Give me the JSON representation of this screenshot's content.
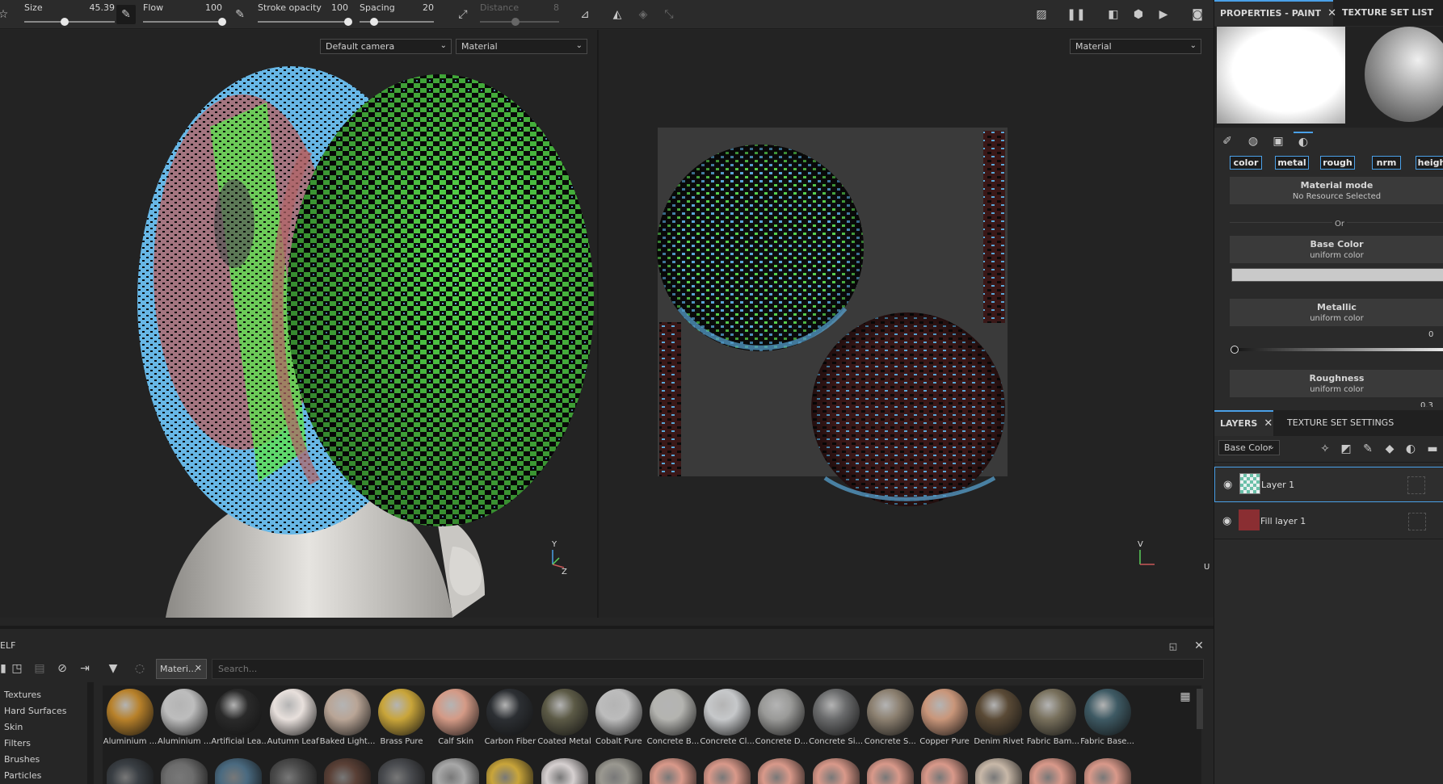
{
  "toolbar": {
    "size": {
      "label": "Size",
      "value": "45.39",
      "level": 0.45
    },
    "flow": {
      "label": "Flow",
      "value": "100",
      "level": 1.0
    },
    "stroke_opacity": {
      "label": "Stroke opacity",
      "value": "100",
      "level": 1.0
    },
    "spacing": {
      "label": "Spacing",
      "value": "20",
      "level": 0.2
    },
    "distance": {
      "label": "Distance",
      "value": "8",
      "level": 0.45
    }
  },
  "viewport3d": {
    "camera_select": "Default camera",
    "channel_select": "Material",
    "axis_y": "Y",
    "axis_z": "Z"
  },
  "viewport2d": {
    "channel_select": "Material",
    "axis_v": "V",
    "axis_u": "U"
  },
  "properties": {
    "tab_active": "PROPERTIES - PAINT",
    "tab_other": "TEXTURE SET LIST",
    "channels": [
      "color",
      "metal",
      "rough",
      "nrm",
      "heigh"
    ],
    "material_mode": {
      "title": "Material mode",
      "sub": "No Resource Selected"
    },
    "or_label": "Or",
    "base_color": {
      "title": "Base Color",
      "sub": "uniform color",
      "swatch": "#c9c9c9"
    },
    "metallic": {
      "title": "Metallic",
      "sub": "uniform color",
      "value": "0",
      "level": 0
    },
    "roughness": {
      "title": "Roughness",
      "sub": "uniform color",
      "value": "0.3"
    }
  },
  "layers": {
    "tab_active": "LAYERS",
    "tab_other": "TEXTURE SET SETTINGS",
    "blend_select": "Base Color",
    "items": [
      {
        "name": "Layer 1",
        "selected": true
      },
      {
        "name": "Fill layer 1",
        "selected": false
      }
    ]
  },
  "shelf": {
    "title": "ELF",
    "filter_chip": "Materi...",
    "search_placeholder": "Search...",
    "categories": [
      "Textures",
      "Hard Surfaces",
      "Skin",
      "Filters",
      "Brushes",
      "Particles"
    ],
    "materials": [
      {
        "name": "Aluminium ...",
        "color": "#b8812a"
      },
      {
        "name": "Aluminium ...",
        "color": "#bdbdbd"
      },
      {
        "name": "Artificial Lea...",
        "color": "#2a2a2a"
      },
      {
        "name": "Autumn Leaf",
        "color": "#e8e0dc"
      },
      {
        "name": "Baked Light...",
        "color": "#b9a596"
      },
      {
        "name": "Brass Pure",
        "color": "#c9a53a"
      },
      {
        "name": "Calf Skin",
        "color": "#d49a86"
      },
      {
        "name": "Carbon Fiber",
        "color": "#2c2f33"
      },
      {
        "name": "Coated Metal",
        "color": "#5c5a46"
      },
      {
        "name": "Cobalt Pure",
        "color": "#bcbcbc"
      },
      {
        "name": "Concrete B...",
        "color": "#b4b4b0"
      },
      {
        "name": "Concrete Cl...",
        "color": "#c6c8ca"
      },
      {
        "name": "Concrete D...",
        "color": "#9a9a98"
      },
      {
        "name": "Concrete Si...",
        "color": "#6a6b6c"
      },
      {
        "name": "Concrete S...",
        "color": "#8c8070"
      },
      {
        "name": "Copper Pure",
        "color": "#c9967a"
      },
      {
        "name": "Denim Rivet",
        "color": "#5a4a36"
      },
      {
        "name": "Fabric Bam...",
        "color": "#78705c"
      },
      {
        "name": "Fabric Base...",
        "color": "#3e5a64"
      }
    ],
    "row2_colors": [
      "#3a3f44",
      "#6d6d6d",
      "#4a6a80",
      "#4c4c4c",
      "#5a4036",
      "#4a4c50",
      "#a8a8a8",
      "#c9a53a",
      "#d6d0d0",
      "#9a9890",
      "#d9998a",
      "#d9998a",
      "#d9998a",
      "#d9998a",
      "#d9998a",
      "#d9998a",
      "#c8b8a8",
      "#d9998a",
      "#d9998a"
    ]
  }
}
